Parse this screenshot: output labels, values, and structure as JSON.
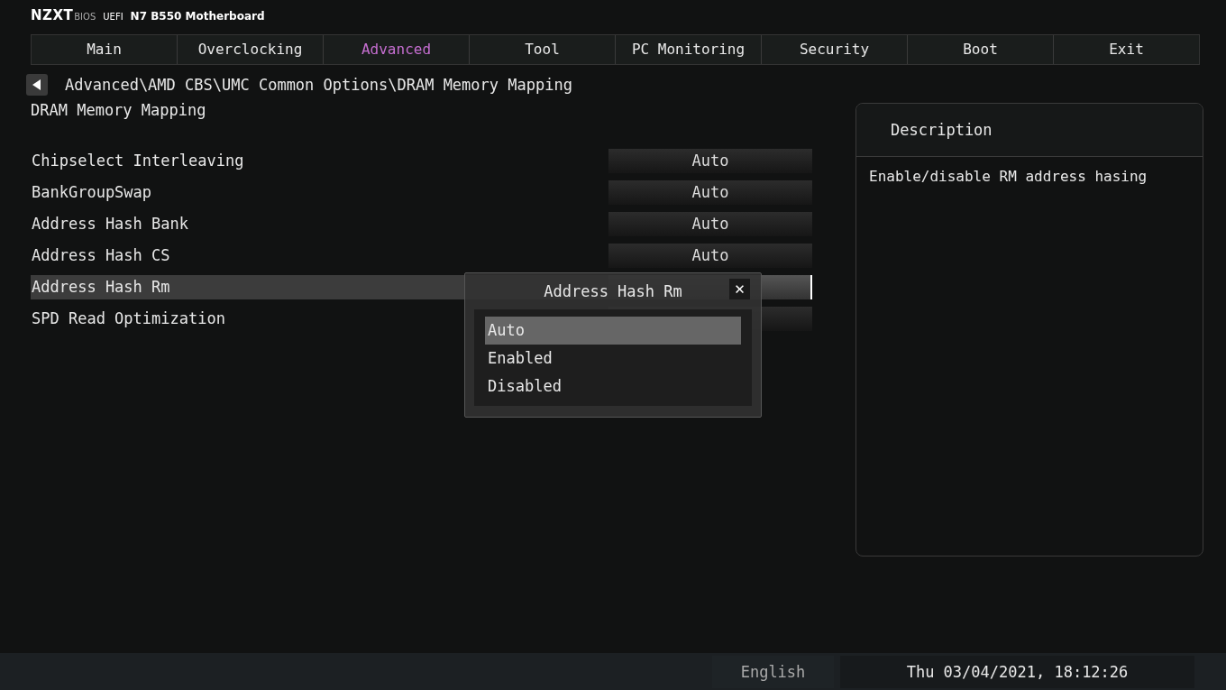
{
  "header": {
    "brand": "NZXT",
    "brand_sub": "BIOS",
    "mode": "UEFI",
    "board": "N7 B550 Motherboard"
  },
  "tabs": [
    {
      "label": "Main",
      "selected": false
    },
    {
      "label": "Overclocking",
      "selected": false
    },
    {
      "label": "Advanced",
      "selected": true
    },
    {
      "label": "Tool",
      "selected": false
    },
    {
      "label": "PC Monitoring",
      "selected": false
    },
    {
      "label": "Security",
      "selected": false
    },
    {
      "label": "Boot",
      "selected": false
    },
    {
      "label": "Exit",
      "selected": false
    }
  ],
  "breadcrumb": "Advanced\\AMD CBS\\UMC Common Options\\DRAM Memory Mapping",
  "page_title": "DRAM Memory Mapping",
  "settings": [
    {
      "name": "Chipselect Interleaving",
      "value": "Auto",
      "selected": false
    },
    {
      "name": "BankGroupSwap",
      "value": "Auto",
      "selected": false
    },
    {
      "name": "Address Hash Bank",
      "value": "Auto",
      "selected": false
    },
    {
      "name": "Address Hash CS",
      "value": "Auto",
      "selected": false
    },
    {
      "name": "Address Hash Rm",
      "selected": true
    },
    {
      "name": "SPD Read Optimization",
      "selected": false
    }
  ],
  "popup": {
    "title": "Address Hash Rm",
    "close": "✕",
    "options": [
      {
        "label": "Auto",
        "selected": true
      },
      {
        "label": "Enabled",
        "selected": false
      },
      {
        "label": "Disabled",
        "selected": false
      }
    ]
  },
  "description": {
    "title": "Description",
    "text": "Enable/disable RM address hasing"
  },
  "status_bar": {
    "language": "English",
    "datetime": "Thu 03/04/2021, 18:12:26"
  }
}
